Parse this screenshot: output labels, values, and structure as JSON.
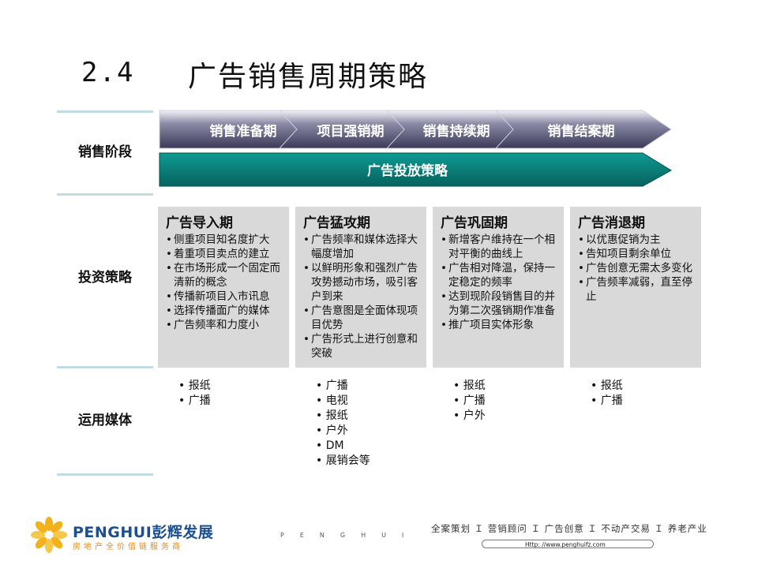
{
  "title": {
    "number": "2.4",
    "text": "广告销售周期策略"
  },
  "row_labels": {
    "sales_stage": "销售阶段",
    "investment": "投资策略",
    "media": "运用媒体"
  },
  "stages": [
    "销售准备期",
    "项目强销期",
    "销售持续期",
    "销售结案期"
  ],
  "ad_strategy_bar": "广告投放策略",
  "colors": {
    "stage_dark": "#4a4a6a",
    "stage_light": "#e8e8f0",
    "bar_teal": "#0d8c86",
    "rule": "#c3dbe2",
    "panel": "#d9d9d9"
  },
  "strategy_columns": [
    {
      "heading": "广告导入期",
      "items": [
        "侧重项目知名度扩大",
        "着重项目卖点的建立",
        "在市场形成一个固定而清新的概念",
        "传播新项目入市讯息",
        "选择传播面广的媒体",
        "广告频率和力度小"
      ]
    },
    {
      "heading": "广告猛攻期",
      "items": [
        "广告频率和媒体选择大幅度增加",
        "以鲜明形象和强烈广告攻势撼动市场，吸引客户到来",
        "广告意图是全面体现项目优势",
        "广告形式上进行创意和突破"
      ]
    },
    {
      "heading": "广告巩固期",
      "items": [
        "新增客户维持在一个相对平衡的曲线上",
        "广告相对降温，保持一定稳定的频率",
        "达到现阶段销售目的并为第二次强销期作准备",
        "推广项目实体形象"
      ]
    },
    {
      "heading": "广告消退期",
      "items": [
        "以优惠促销为主",
        "告知项目剩余单位",
        "广告创意无需太多变化",
        "广告频率减弱，直至停止"
      ]
    }
  ],
  "media_columns": [
    [
      "报纸",
      "广播"
    ],
    [
      "广播",
      "电视",
      "报纸",
      "户外",
      "DM",
      "展销会等"
    ],
    [
      "报纸",
      "广播",
      "户外"
    ],
    [
      "报纸",
      "广播"
    ]
  ],
  "footer": {
    "brand_en": "PENGHUI",
    "brand_cn": "彭辉发展",
    "slogan": "房地产全价值链服务商",
    "spaced_text": "PENGHUI",
    "services": "全案策划 Ｉ 营销顾问 Ｉ 广告创意 Ｉ 不动产交易 Ｉ 养老产业",
    "url": "Http: //www.penghuifz.com"
  }
}
